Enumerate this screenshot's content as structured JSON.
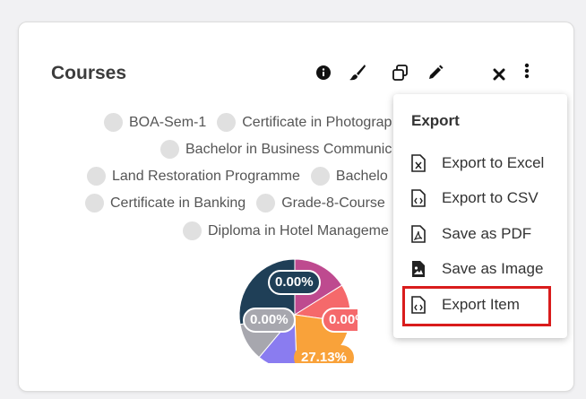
{
  "card": {
    "title": "Courses"
  },
  "toolbar": {
    "info_icon": "info-icon",
    "brush_icon": "paintbrush-icon",
    "clone_icon": "clone-icon",
    "edit_icon": "pencil-icon",
    "close_icon": "close-icon",
    "more_icon": "more-vertical-icon"
  },
  "legend": {
    "rows": [
      [
        "BOA-Sem-1",
        "Certificate in Photograp"
      ],
      [
        "Bachelor in Business Communic"
      ],
      [
        "Land Restoration Programme",
        "Bachelo"
      ],
      [
        "Certificate in Banking",
        "Grade-8-Course"
      ],
      [
        "Diploma in Hotel Manageme"
      ]
    ]
  },
  "chart_data": {
    "type": "pie",
    "slices": [
      {
        "label": "0.00%",
        "color": "#be4a8f"
      },
      {
        "label": "0.00%",
        "color": "#f5696b"
      },
      {
        "label": "27.13%",
        "color": "#f9a23a"
      },
      {
        "label": "",
        "color": "#8a7cf0"
      },
      {
        "label": "0.00%",
        "color": "#a7a7ae"
      },
      {
        "label": "0.00%",
        "color": "#1f3f57"
      }
    ]
  },
  "menu": {
    "title": "Export",
    "items": [
      {
        "label": "Export to Excel",
        "icon": "excel-file-icon"
      },
      {
        "label": "Export to CSV",
        "icon": "csv-file-icon"
      },
      {
        "label": "Save as PDF",
        "icon": "pdf-file-icon"
      },
      {
        "label": "Save as Image",
        "icon": "image-file-icon"
      },
      {
        "label": "Export Item",
        "icon": "code-file-icon"
      }
    ]
  },
  "colors": {
    "highlight": "#d91c1c",
    "legend_dot": "#e0e0e0"
  }
}
